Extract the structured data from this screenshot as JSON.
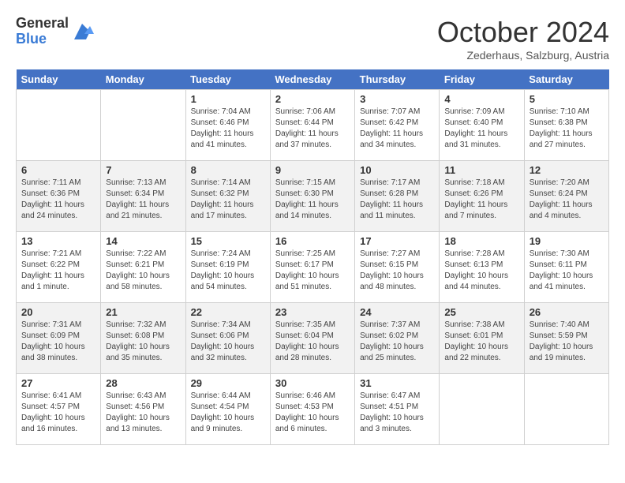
{
  "logo": {
    "general": "General",
    "blue": "Blue"
  },
  "title": "October 2024",
  "location": "Zederhaus, Salzburg, Austria",
  "days_of_week": [
    "Sunday",
    "Monday",
    "Tuesday",
    "Wednesday",
    "Thursday",
    "Friday",
    "Saturday"
  ],
  "weeks": [
    [
      {
        "day": "",
        "info": ""
      },
      {
        "day": "",
        "info": ""
      },
      {
        "day": "1",
        "info": "Sunrise: 7:04 AM\nSunset: 6:46 PM\nDaylight: 11 hours and 41 minutes."
      },
      {
        "day": "2",
        "info": "Sunrise: 7:06 AM\nSunset: 6:44 PM\nDaylight: 11 hours and 37 minutes."
      },
      {
        "day": "3",
        "info": "Sunrise: 7:07 AM\nSunset: 6:42 PM\nDaylight: 11 hours and 34 minutes."
      },
      {
        "day": "4",
        "info": "Sunrise: 7:09 AM\nSunset: 6:40 PM\nDaylight: 11 hours and 31 minutes."
      },
      {
        "day": "5",
        "info": "Sunrise: 7:10 AM\nSunset: 6:38 PM\nDaylight: 11 hours and 27 minutes."
      }
    ],
    [
      {
        "day": "6",
        "info": "Sunrise: 7:11 AM\nSunset: 6:36 PM\nDaylight: 11 hours and 24 minutes."
      },
      {
        "day": "7",
        "info": "Sunrise: 7:13 AM\nSunset: 6:34 PM\nDaylight: 11 hours and 21 minutes."
      },
      {
        "day": "8",
        "info": "Sunrise: 7:14 AM\nSunset: 6:32 PM\nDaylight: 11 hours and 17 minutes."
      },
      {
        "day": "9",
        "info": "Sunrise: 7:15 AM\nSunset: 6:30 PM\nDaylight: 11 hours and 14 minutes."
      },
      {
        "day": "10",
        "info": "Sunrise: 7:17 AM\nSunset: 6:28 PM\nDaylight: 11 hours and 11 minutes."
      },
      {
        "day": "11",
        "info": "Sunrise: 7:18 AM\nSunset: 6:26 PM\nDaylight: 11 hours and 7 minutes."
      },
      {
        "day": "12",
        "info": "Sunrise: 7:20 AM\nSunset: 6:24 PM\nDaylight: 11 hours and 4 minutes."
      }
    ],
    [
      {
        "day": "13",
        "info": "Sunrise: 7:21 AM\nSunset: 6:22 PM\nDaylight: 11 hours and 1 minute."
      },
      {
        "day": "14",
        "info": "Sunrise: 7:22 AM\nSunset: 6:21 PM\nDaylight: 10 hours and 58 minutes."
      },
      {
        "day": "15",
        "info": "Sunrise: 7:24 AM\nSunset: 6:19 PM\nDaylight: 10 hours and 54 minutes."
      },
      {
        "day": "16",
        "info": "Sunrise: 7:25 AM\nSunset: 6:17 PM\nDaylight: 10 hours and 51 minutes."
      },
      {
        "day": "17",
        "info": "Sunrise: 7:27 AM\nSunset: 6:15 PM\nDaylight: 10 hours and 48 minutes."
      },
      {
        "day": "18",
        "info": "Sunrise: 7:28 AM\nSunset: 6:13 PM\nDaylight: 10 hours and 44 minutes."
      },
      {
        "day": "19",
        "info": "Sunrise: 7:30 AM\nSunset: 6:11 PM\nDaylight: 10 hours and 41 minutes."
      }
    ],
    [
      {
        "day": "20",
        "info": "Sunrise: 7:31 AM\nSunset: 6:09 PM\nDaylight: 10 hours and 38 minutes."
      },
      {
        "day": "21",
        "info": "Sunrise: 7:32 AM\nSunset: 6:08 PM\nDaylight: 10 hours and 35 minutes."
      },
      {
        "day": "22",
        "info": "Sunrise: 7:34 AM\nSunset: 6:06 PM\nDaylight: 10 hours and 32 minutes."
      },
      {
        "day": "23",
        "info": "Sunrise: 7:35 AM\nSunset: 6:04 PM\nDaylight: 10 hours and 28 minutes."
      },
      {
        "day": "24",
        "info": "Sunrise: 7:37 AM\nSunset: 6:02 PM\nDaylight: 10 hours and 25 minutes."
      },
      {
        "day": "25",
        "info": "Sunrise: 7:38 AM\nSunset: 6:01 PM\nDaylight: 10 hours and 22 minutes."
      },
      {
        "day": "26",
        "info": "Sunrise: 7:40 AM\nSunset: 5:59 PM\nDaylight: 10 hours and 19 minutes."
      }
    ],
    [
      {
        "day": "27",
        "info": "Sunrise: 6:41 AM\nSunset: 4:57 PM\nDaylight: 10 hours and 16 minutes."
      },
      {
        "day": "28",
        "info": "Sunrise: 6:43 AM\nSunset: 4:56 PM\nDaylight: 10 hours and 13 minutes."
      },
      {
        "day": "29",
        "info": "Sunrise: 6:44 AM\nSunset: 4:54 PM\nDaylight: 10 hours and 9 minutes."
      },
      {
        "day": "30",
        "info": "Sunrise: 6:46 AM\nSunset: 4:53 PM\nDaylight: 10 hours and 6 minutes."
      },
      {
        "day": "31",
        "info": "Sunrise: 6:47 AM\nSunset: 4:51 PM\nDaylight: 10 hours and 3 minutes."
      },
      {
        "day": "",
        "info": ""
      },
      {
        "day": "",
        "info": ""
      }
    ]
  ]
}
